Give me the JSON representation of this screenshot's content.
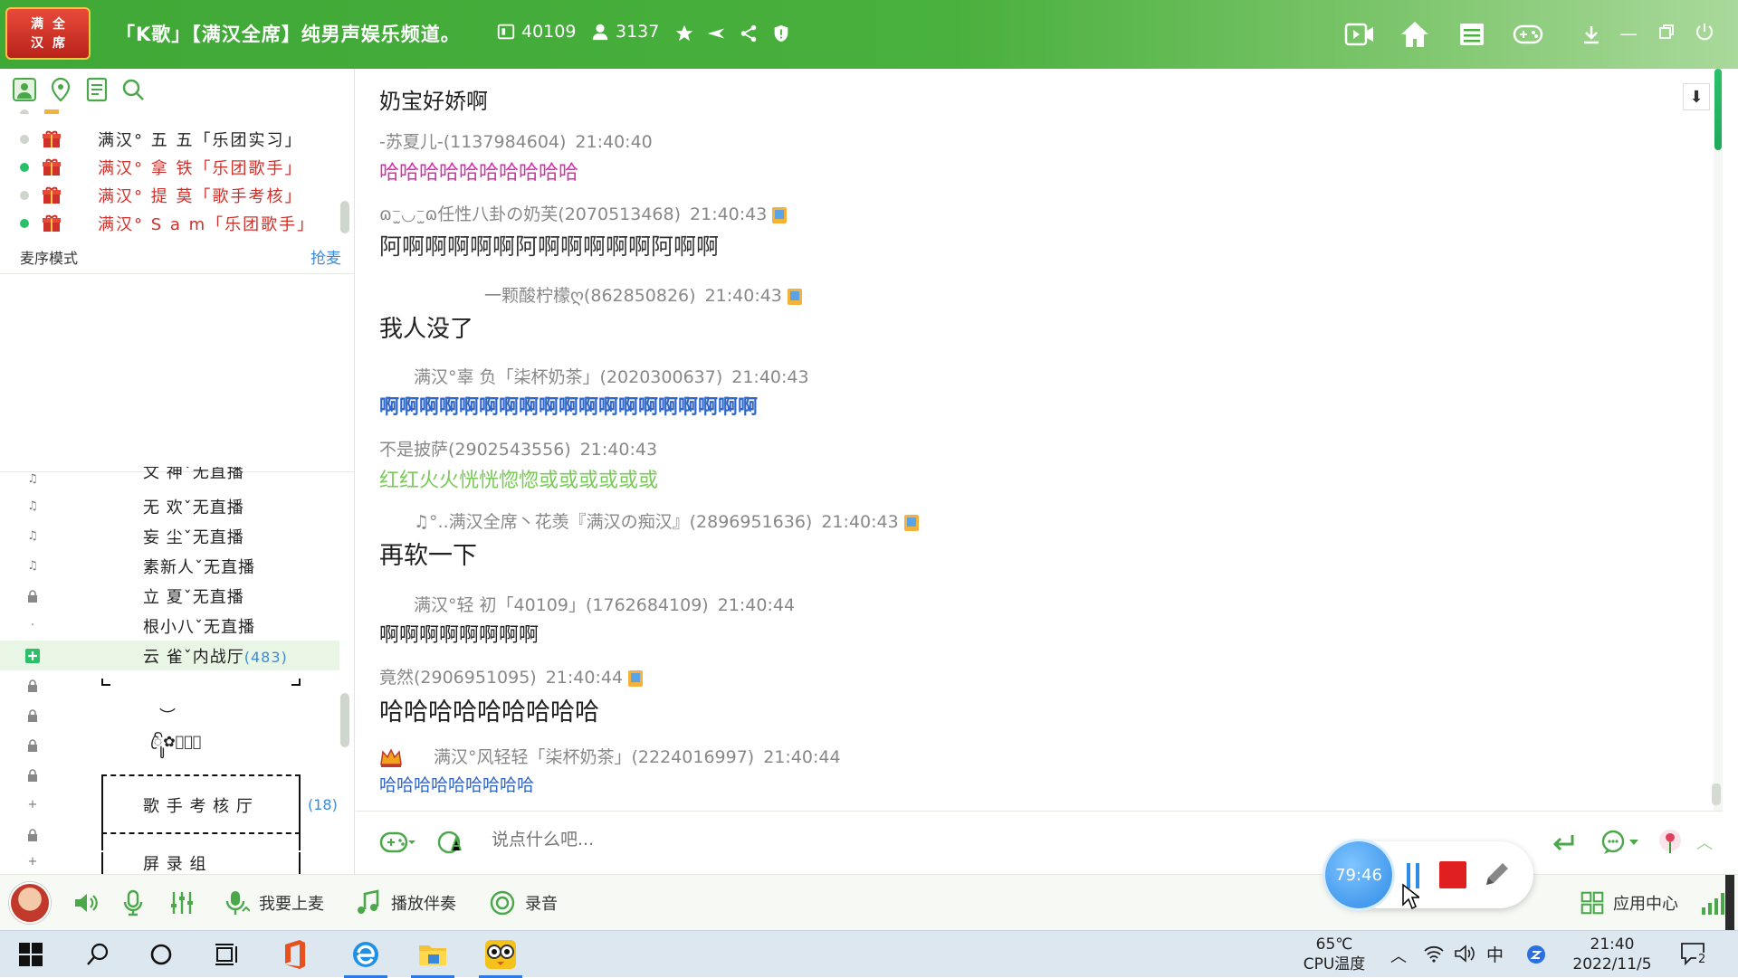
{
  "titlebar": {
    "logo_chars": [
      "满",
      "全",
      "汉",
      "席"
    ],
    "room_name": "「K歌」【满汉全席】纯男声娱乐频道。",
    "room_id": "40109",
    "online_count": "3137",
    "icons": [
      "room-id-icon",
      "user-count-icon",
      "star-icon",
      "plane-icon",
      "share-icon",
      "shield-icon",
      "video-icon",
      "home-icon",
      "list-icon",
      "game-icon",
      "download-icon",
      "minimize-icon",
      "restore-icon",
      "power-icon"
    ]
  },
  "left": {
    "top_members": [
      {
        "name": "满汉° 五  五「乐团实习」",
        "online": false,
        "color": "#222222"
      },
      {
        "name": "满汉° 拿  铁「乐团歌手」",
        "online": true,
        "color": "#d0302a"
      },
      {
        "name": "满汉° 提  莫「歌手考核」",
        "online": false,
        "color": "#d0302a"
      },
      {
        "name": "满汉° S a m「乐团歌手」",
        "online": true,
        "color": "#d0302a"
      }
    ],
    "queue_mode_label": "麦序模式",
    "grab_mic_label": "抢麦",
    "channels": [
      {
        "name": "文  神ˇ无直播",
        "icon": "music-lock-icon",
        "count": ""
      },
      {
        "name": "无  欢ˇ无直播",
        "icon": "music-lock-icon",
        "count": ""
      },
      {
        "name": "妄  尘ˇ无直播",
        "icon": "music-lock-icon",
        "count": ""
      },
      {
        "name": "素新人ˇ无直播",
        "icon": "music-icon",
        "count": ""
      },
      {
        "name": "立  夏ˇ无直播",
        "icon": "lock-icon",
        "count": ""
      },
      {
        "name": "根小八ˇ无直播",
        "icon": "dot-icon",
        "count": ""
      },
      {
        "name": "云  雀ˇ内战厅",
        "icon": "add-green-icon",
        "count": "(483)"
      }
    ],
    "deco_1": "︶",
    "deco_2": "ꦿꦼꦸ✿ꦸꦼꦿ",
    "singer_hall": "歌 手 考 核 厅",
    "singer_hall_count": "(18)",
    "record_group": "屏   录   组"
  },
  "chat": {
    "messages": [
      {
        "meta": "",
        "time": "",
        "text": "奶宝好娇啊",
        "color": "#222222",
        "size": 24,
        "badge": false
      },
      {
        "meta": "-苏夏儿-(1137984604)",
        "time": "21:40:40",
        "text": "哈哈哈哈哈哈哈哈哈哈",
        "color": "#d431a8",
        "size": 22,
        "badge": false
      },
      {
        "meta": "ɷ⁻̫◡⁻̫ɷ任性八卦の奶芙(2070513468)",
        "time": "21:40:43",
        "text": "阿啊啊啊啊啊阿啊啊啊啊啊阿啊啊",
        "color": "#333333",
        "size": 25,
        "badge": true
      },
      {
        "meta": "一颗酸柠檬ღ(862850826)",
        "time": "21:40:43",
        "text": "我人没了",
        "color": "#222222",
        "size": 26,
        "badge": true
      },
      {
        "meta": "满汉°辜  负「柒杯奶茶」(2020300637)",
        "time": "21:40:43",
        "text": "啊啊啊啊啊啊啊啊啊啊啊啊啊啊啊啊啊啊啊",
        "color": "#2f66c7",
        "size": 22,
        "badge": false
      },
      {
        "meta": "不是披萨(2902543556)",
        "time": "21:40:43",
        "text": "红红火火恍恍惚惚或或或或或或",
        "color": "#7bc95a",
        "size": 22,
        "badge": false
      },
      {
        "meta": "♫°..满汉全席丶花羡『满汉の痴汉』(2896951636)",
        "time": "21:40:43",
        "text": "再软一下",
        "color": "#222222",
        "size": 27,
        "badge": true
      },
      {
        "meta": "满汉°轻  初「40109」(1762684109)",
        "time": "21:40:44",
        "text": "啊啊啊啊啊啊啊啊",
        "color": "#222222",
        "size": 22,
        "badge": false
      },
      {
        "meta": "竟然(2906951095)",
        "time": "21:40:44",
        "text": "哈哈哈哈哈哈哈哈哈",
        "color": "#222222",
        "size": 27,
        "badge": true
      },
      {
        "meta": "满汉°风轻轻「柒杯奶茶」(2224016997)",
        "time": "21:40:44",
        "text": "哈哈哈哈哈哈哈哈哈",
        "color": "#2f66c7",
        "size": 19,
        "badge": false
      }
    ]
  },
  "input": {
    "placeholder": "说点什么吧..."
  },
  "bottom": {
    "apply_mic": "我要上麦",
    "play_accompaniment": "播放伴奏",
    "record": "录音",
    "app_center": "应用中心"
  },
  "recorder": {
    "timer": "79:46"
  },
  "taskbar": {
    "temp": "65℃",
    "temp_label": "CPU温度",
    "ime": "中",
    "time": "21:40",
    "date": "2022/11/5",
    "notif_count": "2"
  }
}
